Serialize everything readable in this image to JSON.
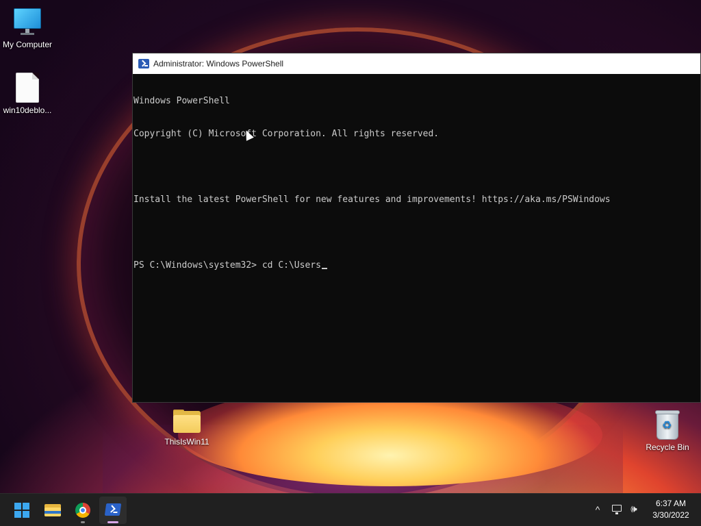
{
  "desktop": {
    "icons": [
      {
        "label": "My Computer",
        "icon": "monitor-icon"
      },
      {
        "label": "win10deblo...",
        "icon": "file-icon"
      },
      {
        "label": "ThisIsWin11",
        "icon": "folder-icon"
      },
      {
        "label": "Recycle Bin",
        "icon": "recycle-bin-icon"
      }
    ]
  },
  "window": {
    "title": "Administrator: Windows PowerShell",
    "icon": "powershell-icon",
    "console": {
      "lines": [
        "Windows PowerShell",
        "Copyright (C) Microsoft Corporation. All rights reserved.",
        "",
        "Install the latest PowerShell for new features and improvements! https://aka.ms/PSWindows",
        ""
      ],
      "prompt": "PS C:\\Windows\\system32> ",
      "input": "cd C:\\Users"
    }
  },
  "taskbar": {
    "apps": [
      {
        "name": "Start",
        "icon": "windows-start-icon"
      },
      {
        "name": "File Explorer",
        "icon": "file-explorer-icon"
      },
      {
        "name": "Google Chrome",
        "icon": "chrome-icon"
      },
      {
        "name": "Windows PowerShell",
        "icon": "powershell-icon",
        "active": true
      }
    ],
    "tray": {
      "chevron_glyph": "^",
      "volume_glyph": "🕪",
      "time": "6:37 AM",
      "date": "3/30/2022"
    }
  },
  "colors": {
    "console_bg": "#0c0c0c",
    "console_fg": "#cccccc",
    "taskbar_bg": "#202020",
    "accent": "#3ca8f0"
  }
}
